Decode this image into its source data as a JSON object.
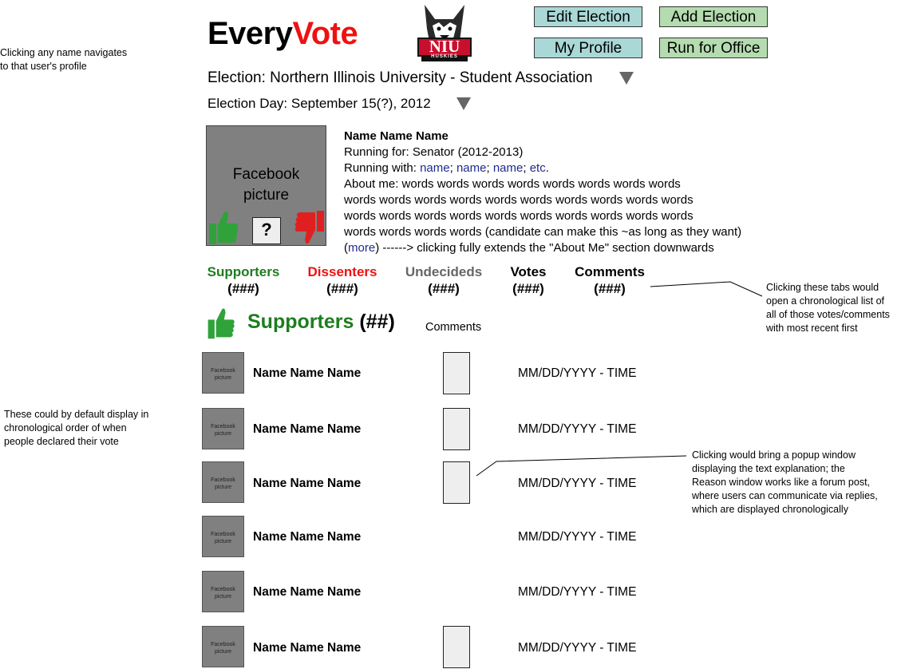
{
  "header": {
    "logo_part1": "Every",
    "logo_part2": "Vote",
    "school_logo_text": "NIU",
    "school_logo_subtext": "HUSKIES",
    "buttons": {
      "edit_election": "Edit Election",
      "add_election": "Add Election",
      "my_profile": "My Profile",
      "run_for_office": "Run for Office"
    },
    "election_label": "Election: Northern Illinois University - Student Association",
    "election_day_label": "Election Day: September 15(?), 2012"
  },
  "notes": {
    "names_nav_line1": "Clicking any name navigates",
    "names_nav_line2": "to that user's profile",
    "default_order_line1": "These could by default display in",
    "default_order_line2": "chronological order of when",
    "default_order_line3": "people declared their vote",
    "tabs_line1": "Clicking these tabs would",
    "tabs_line2": "open a chronological list of",
    "tabs_line3": "all of those votes/comments",
    "tabs_line4": "with most recent first",
    "popup_line1": "Clicking would bring a popup window",
    "popup_line2": "displaying the text explanation; the",
    "popup_line3": "Reason window works like a forum post,",
    "popup_line4": "where users can communicate via replies,",
    "popup_line5": "which are displayed chronologically"
  },
  "profile": {
    "picture_line1": "Facebook",
    "picture_line2": "picture",
    "vote_unknown": "?",
    "name": "Name Name Name",
    "running_for": "Running for: Senator (2012-2013)",
    "running_with_label": "Running with:",
    "running_with": [
      "name",
      "name",
      "name",
      "etc"
    ],
    "about_line1": "About me: words words words words words words words words",
    "about_line2": "words words words words words words words words words words",
    "about_line3": "words words words words words words words words words words",
    "about_line4": "words words words words (candidate can make this ~as long as they want)",
    "more_open": "(",
    "more_link": "more",
    "more_rest": ") ------> clicking fully extends the \"About Me\" section downwards"
  },
  "tabs": [
    {
      "label": "Supporters",
      "count": "(###)",
      "color": "#1e7d1e"
    },
    {
      "label": "Dissenters",
      "count": "(###)",
      "color": "#ee1111"
    },
    {
      "label": "Undecideds",
      "count": "(###)",
      "color": "#666666"
    },
    {
      "label": "Votes",
      "count": "(###)",
      "color": "#000000"
    },
    {
      "label": "Comments",
      "count": "(###)",
      "color": "#000000"
    }
  ],
  "section": {
    "title": "Supporters",
    "count": "(##)",
    "comments_header": "Comments"
  },
  "rows": [
    {
      "pic_line1": "Facebook",
      "pic_line2": "picture",
      "name": "Name Name Name",
      "date": "MM/DD/YYYY - TIME",
      "has_comment": true
    },
    {
      "pic_line1": "Facebook",
      "pic_line2": "picture",
      "name": "Name Name Name",
      "date": "MM/DD/YYYY - TIME",
      "has_comment": true
    },
    {
      "pic_line1": "Facebook",
      "pic_line2": "picture",
      "name": "Name Name Name",
      "date": "MM/DD/YYYY - TIME",
      "has_comment": true
    },
    {
      "pic_line1": "Facebook",
      "pic_line2": "picture",
      "name": "Name Name Name",
      "date": "MM/DD/YYYY - TIME",
      "has_comment": false
    },
    {
      "pic_line1": "Facebook",
      "pic_line2": "picture",
      "name": "Name Name Name",
      "date": "MM/DD/YYYY - TIME",
      "has_comment": false
    },
    {
      "pic_line1": "Facebook",
      "pic_line2": "picture",
      "name": "Name Name Name",
      "date": "MM/DD/YYYY - TIME",
      "has_comment": true
    }
  ],
  "colors": {
    "accent_red": "#ee1111",
    "supporter_green": "#1e7d1e",
    "thumb_green": "#2fa23a",
    "thumb_red": "#e02020",
    "button_teal": "#a9d8d6",
    "button_green": "#b5dcb0"
  },
  "icons": {
    "thumbs_up": "thumbs-up-icon",
    "thumbs_down": "thumbs-down-icon",
    "dropdown": "triangle-down-icon",
    "school_logo": "husky-logo-icon"
  }
}
